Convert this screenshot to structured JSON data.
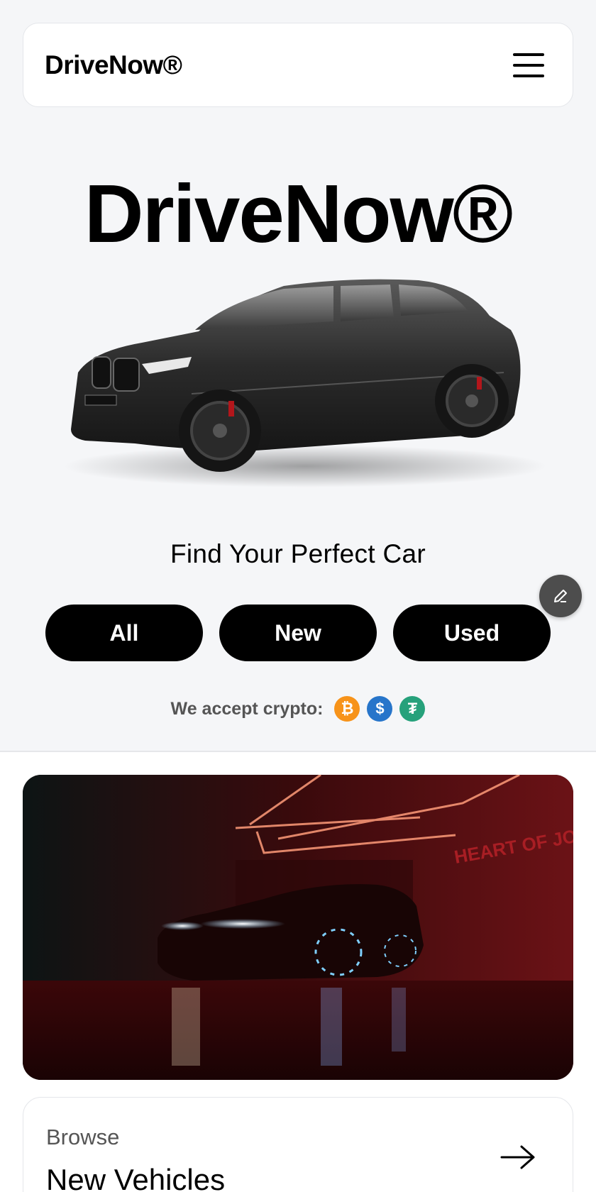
{
  "header": {
    "brand": "DriveNow®",
    "menu_icon": "hamburger-menu-icon"
  },
  "hero": {
    "title": "DriveNow®",
    "subtitle": "Find Your Perfect Car",
    "filters": [
      {
        "label": "All"
      },
      {
        "label": "New"
      },
      {
        "label": "Used"
      }
    ]
  },
  "crypto": {
    "label": "We accept crypto:",
    "coins": [
      {
        "name": "bitcoin-icon",
        "symbol": "₿",
        "color": "#f7931a"
      },
      {
        "name": "usdc-icon",
        "symbol": "$",
        "color": "#2775ca"
      },
      {
        "name": "tether-icon",
        "symbol": "₮",
        "color": "#26a17b"
      }
    ]
  },
  "browse": {
    "kicker": "Browse",
    "title": "New Vehicles"
  },
  "colors": {
    "background": "#f5f6f8",
    "button": "#000000",
    "accent_red": "#8b0f12"
  }
}
